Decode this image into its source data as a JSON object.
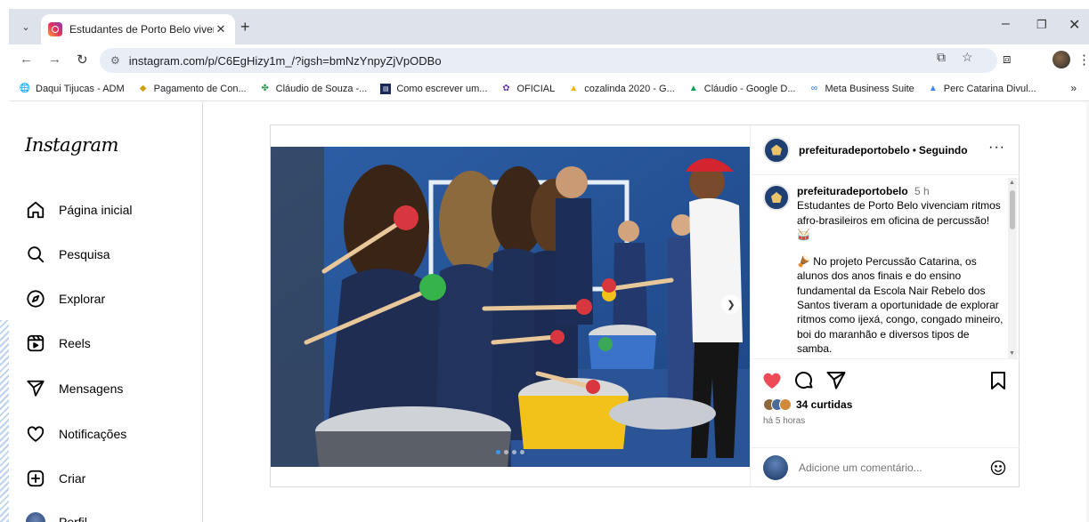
{
  "browser": {
    "tab_title": "Estudantes de Porto Belo viver",
    "tab_close": "✕",
    "new_tab": "+",
    "url": "instagram.com/p/C6EgHizy1m_/?igsh=bmNzYnpyZjVpODBo",
    "bookmarks": [
      {
        "label": "Daqui Tijucas - ADM",
        "icon": "globe-icon"
      },
      {
        "label": "Pagamento de Con...",
        "icon": "bookmark-icon"
      },
      {
        "label": "Cláudio de Souza -...",
        "icon": "pinwheel-icon"
      },
      {
        "label": "Como escrever um...",
        "icon": "page-icon"
      },
      {
        "label": "OFICIAL",
        "icon": "gear-icon"
      },
      {
        "label": "cozalinda 2020 - G...",
        "icon": "drive-icon"
      },
      {
        "label": "Cláudio - Google D...",
        "icon": "drive-icon"
      },
      {
        "label": "Meta Business Suite",
        "icon": "meta-icon"
      },
      {
        "label": "Perc Catarina Divul...",
        "icon": "drive-icon"
      }
    ],
    "bookmarks_more": "»"
  },
  "sidebar": {
    "logo": "Instagram",
    "items": [
      {
        "label": "Página inicial",
        "icon": "home-icon"
      },
      {
        "label": "Pesquisa",
        "icon": "search-icon"
      },
      {
        "label": "Explorar",
        "icon": "compass-icon"
      },
      {
        "label": "Reels",
        "icon": "reels-icon"
      },
      {
        "label": "Mensagens",
        "icon": "send-icon"
      },
      {
        "label": "Notificações",
        "icon": "heart-icon"
      },
      {
        "label": "Criar",
        "icon": "plus-square-icon"
      },
      {
        "label": "Perfil",
        "icon": "profile-avatar"
      }
    ]
  },
  "post": {
    "username": "prefeituradeportobelo",
    "separator": "•",
    "follow_status": "Seguindo",
    "more": "···",
    "caption_user": "prefeituradeportobelo",
    "caption_time": "5 h",
    "caption_line1": "Estudantes de Porto Belo vivenciam ritmos afro-brasileiros em oficina de percussão! 🥁",
    "caption_line2": "🪘 No projeto Percussão Catarina, os alunos dos anos finais e do ensino fundamental da Escola Nair Rebelo dos Santos tiveram a oportunidade de explorar ritmos como ijexá, congo, congado mineiro, boi do maranhão e diversos tipos de samba.",
    "likes": "34 curtidas",
    "time_ago": "há 5 horas",
    "comment_placeholder": "Adicione um comentário...",
    "carousel_total": 4,
    "carousel_active": 1,
    "colors": {
      "like": "#ed4956",
      "link": "#3897f0"
    }
  }
}
